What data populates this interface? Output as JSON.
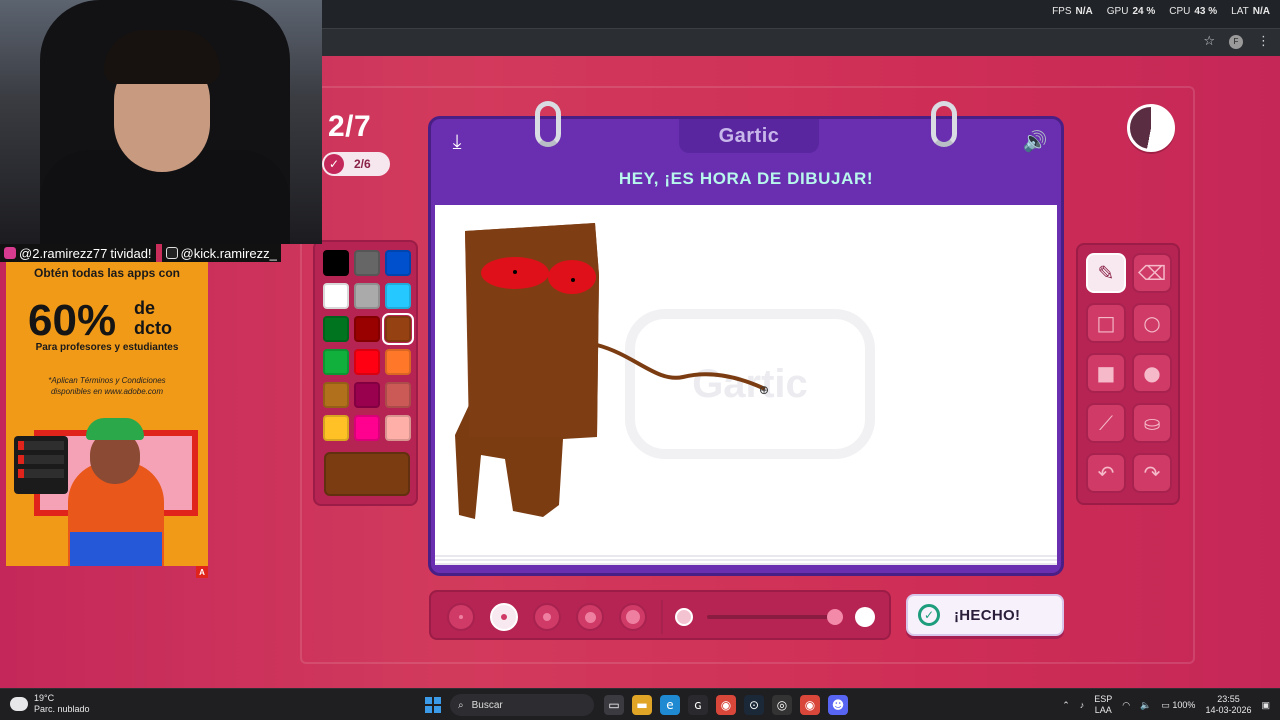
{
  "overlay": {
    "fps_label": "FPS",
    "fps_value": "N/A",
    "gpu_label": "GPU",
    "gpu_value": "24 %",
    "cpu_label": "CPU",
    "cpu_value": "43 %",
    "lat_label": "LAT",
    "lat_value": "N/A"
  },
  "browser": {
    "profile_initial": "F"
  },
  "stream": {
    "instagram": "@2.ramirezz77",
    "title_partial": "tividad!",
    "tiktok": "@kick.ramirezz_"
  },
  "ad": {
    "line1": "Obtén todas las apps con",
    "percent": "60%",
    "de": "de",
    "dcto": "dcto",
    "line3": "Para profesores y estudiantes",
    "terms1": "*Aplican Términos y Condiciones",
    "terms2": "disponibles en www.adobe.com",
    "brand_mark": "A"
  },
  "game": {
    "round": "2/7",
    "players_done": "2/6",
    "logo": "Gartic",
    "instruction": "HEY, ¡ES HORA DE DIBUJAR!",
    "watermark": "Gartic",
    "done_button": "¡HECHO!",
    "timer_remaining_fraction": 0.47,
    "palette": [
      "#000000",
      "#666666",
      "#0050cd",
      "#ffffff",
      "#aaaaaa",
      "#26c9ff",
      "#017420",
      "#990000",
      "#964112",
      "#11b03c",
      "#ff0013",
      "#ff7829",
      "#b0701c",
      "#99004e",
      "#cb5a57",
      "#ffc126",
      "#ff008f",
      "#feafa8"
    ],
    "selected_color": "#7b3c12",
    "tools": [
      "pencil-icon",
      "eraser-icon",
      "rectangle-icon",
      "circle-icon",
      "filled-rectangle-icon",
      "filled-circle-icon",
      "line-icon",
      "fill-bucket-icon",
      "undo-icon",
      "redo-icon"
    ],
    "active_tool": "pencil-icon",
    "brush_sizes": 5,
    "active_brush": 2
  },
  "taskbar": {
    "temp": "19°C",
    "weather": "Parc. nublado",
    "search": "Buscar",
    "lang1": "ESP",
    "lang2": "LAA",
    "battery": "100%",
    "time": "23:55",
    "date": "14-03-2026"
  }
}
